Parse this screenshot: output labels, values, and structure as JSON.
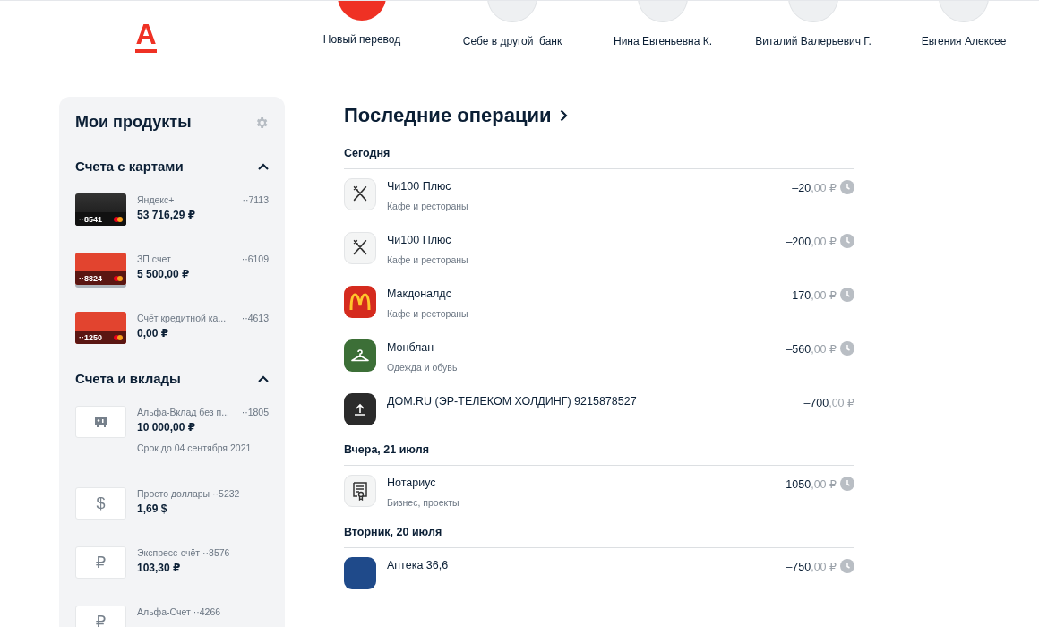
{
  "logo": {
    "letter": "А"
  },
  "transfers": [
    {
      "kind": "new",
      "label": "Новый перевод"
    },
    {
      "kind": "contact",
      "label": "Себе в другой  банк"
    },
    {
      "kind": "contact",
      "label": "Нина Евгеньевна К."
    },
    {
      "kind": "contact",
      "label": "Виталий Валерьевич Г."
    },
    {
      "kind": "contact",
      "label": "Евгения Алексее"
    }
  ],
  "products": {
    "title": "Мои продукты",
    "groups": [
      {
        "title": "Счета с картами",
        "expanded": true,
        "items": [
          {
            "kind": "blackcard",
            "card_number": "··8541",
            "name": "Яндекс+",
            "number": "··7113",
            "balance": "53 716,29 ₽"
          },
          {
            "kind": "redcard",
            "stacked": true,
            "card_number": "··8824",
            "name": "ЗП счет",
            "number": "··6109",
            "balance": "5 500,00 ₽"
          },
          {
            "kind": "redcard",
            "stacked": false,
            "card_number": "··1250",
            "name": "Счёт кредитной ка...",
            "number": "··4613",
            "balance": "0,00 ₽"
          }
        ]
      },
      {
        "title": "Счета и вклады",
        "expanded": true,
        "items": [
          {
            "kind": "deposit",
            "name": "Альфа-Вклад без п...",
            "number": "··1805",
            "balance": "10 000,00 ₽",
            "note": "Срок до 04 сентября 2021"
          },
          {
            "kind": "currency",
            "symbol": "$",
            "name": "Просто доллары",
            "number": "··5232",
            "balance": "1,69 $"
          },
          {
            "kind": "currency",
            "symbol": "₽",
            "name": "Экспресс-счёт",
            "number": "··8576",
            "balance": "103,30 ₽"
          },
          {
            "kind": "currency",
            "symbol": "₽",
            "name": "Альфа-Счет",
            "number": "··4266"
          }
        ]
      }
    ]
  },
  "operations": {
    "title": "Последние операции",
    "days": [
      {
        "label": "Сегодня",
        "items": [
          {
            "kind": "cutlery",
            "name": "Чи100 Плюс",
            "category": "Кафе и рестораны",
            "whole": "–20",
            "cents": ",00 ₽",
            "pending": true
          },
          {
            "kind": "cutlery",
            "name": "Чи100 Плюс",
            "category": "Кафе и рестораны",
            "whole": "–200",
            "cents": ",00 ₽",
            "pending": true
          },
          {
            "kind": "arches",
            "name": "Макдоналдс",
            "category": "Кафе и рестораны",
            "whole": "–170",
            "cents": ",00 ₽",
            "pending": true
          },
          {
            "kind": "hanger",
            "name": "Монблан",
            "category": "Одежда и обувь",
            "whole": "–560",
            "cents": ",00 ₽",
            "pending": true
          },
          {
            "kind": "upload",
            "name": "ДОМ.RU (ЭР-ТЕЛЕКОМ ХОЛДИНГ) 9215878527",
            "whole": "–700",
            "cents": ",00 ₽",
            "pending": false
          }
        ]
      },
      {
        "label": "Вчера, 21 июля",
        "items": [
          {
            "kind": "document",
            "name": "Нотариус",
            "category": "Бизнес, проекты",
            "whole": "–1050",
            "cents": ",00 ₽",
            "pending": true
          }
        ]
      },
      {
        "label": "Вторник, 20 июля",
        "items": [
          {
            "kind": "pharmacy",
            "name": "Аптека 36,6",
            "whole": "–750",
            "cents": ",00 ₽",
            "pending": true
          }
        ]
      }
    ]
  }
}
